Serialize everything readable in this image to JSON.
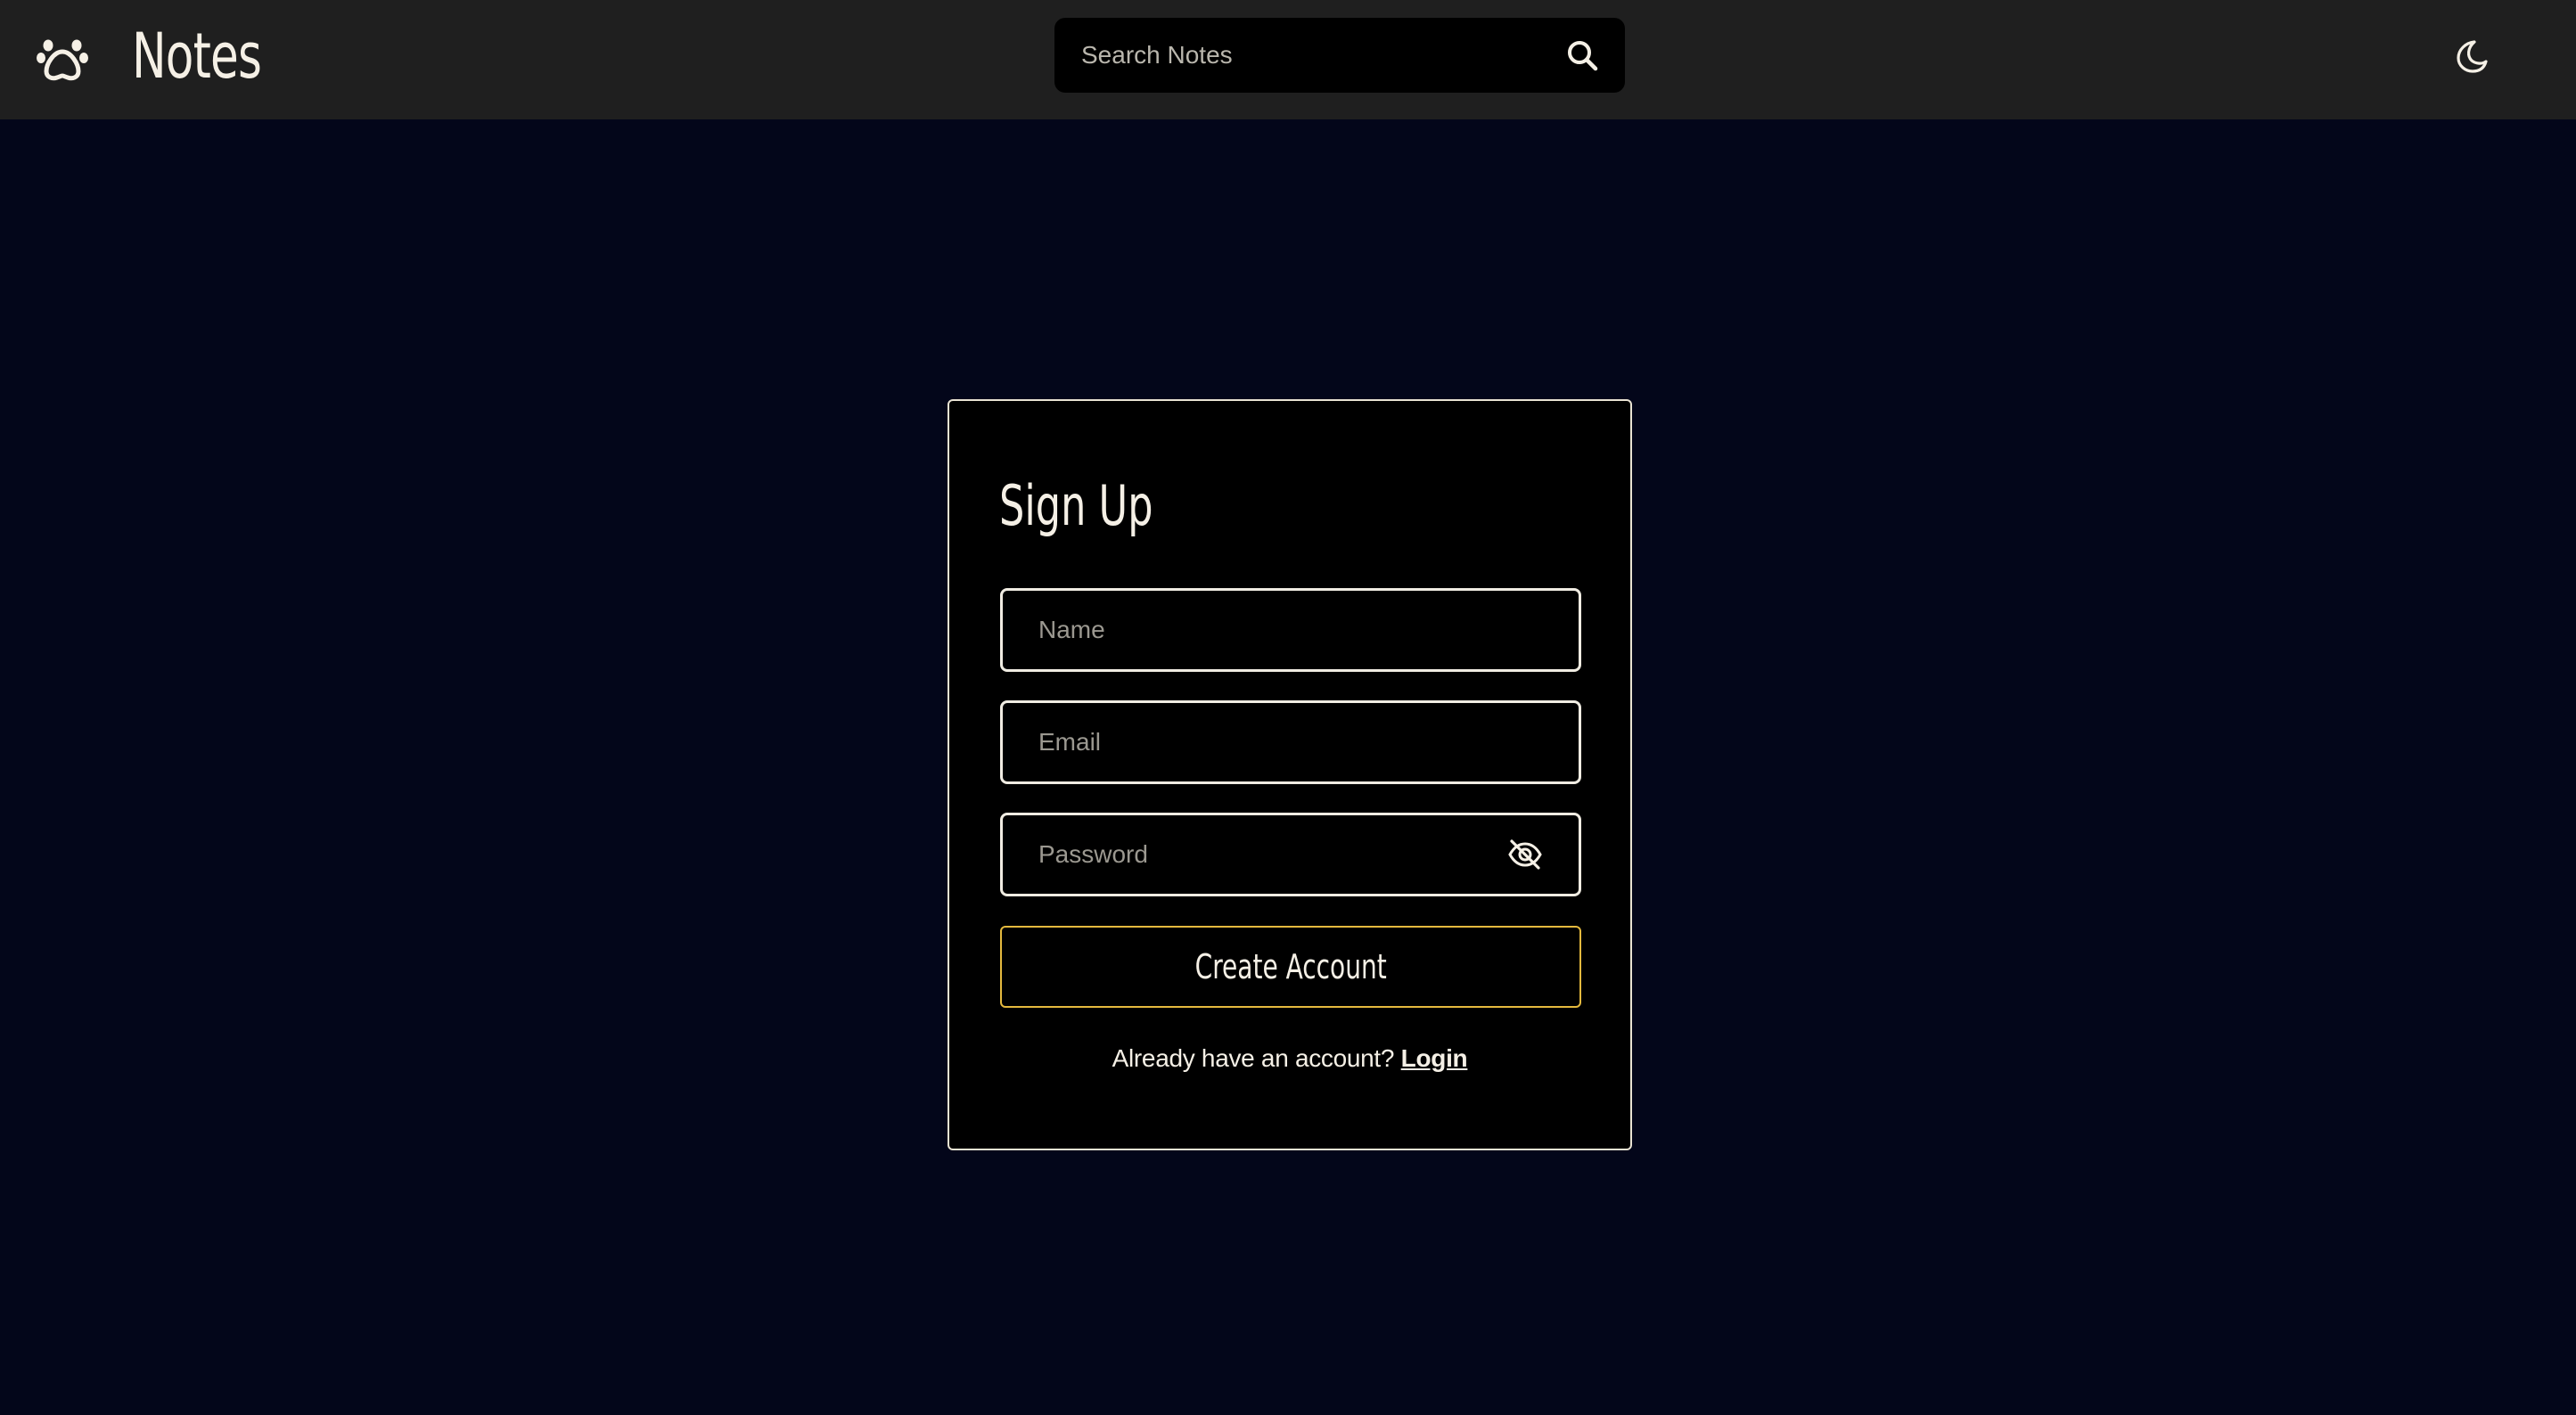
{
  "header": {
    "app_title": "Notes",
    "logo_icon": "paw-icon",
    "search": {
      "placeholder": "Search Notes",
      "icon": "search-icon"
    },
    "theme_toggle_icon": "moon-icon"
  },
  "signup": {
    "title": "Sign Up",
    "name_placeholder": "Name",
    "email_placeholder": "Email",
    "password_placeholder": "Password",
    "password_toggle_icon": "eye-off-icon",
    "submit_label": "Create Account",
    "login_prompt": "Already have an account? ",
    "login_link": "Login"
  },
  "colors": {
    "background": "#03061a",
    "topbar": "#1f1f1f",
    "card": "#000000",
    "text": "#f5f0e6",
    "button_border": "#e4b93e"
  }
}
